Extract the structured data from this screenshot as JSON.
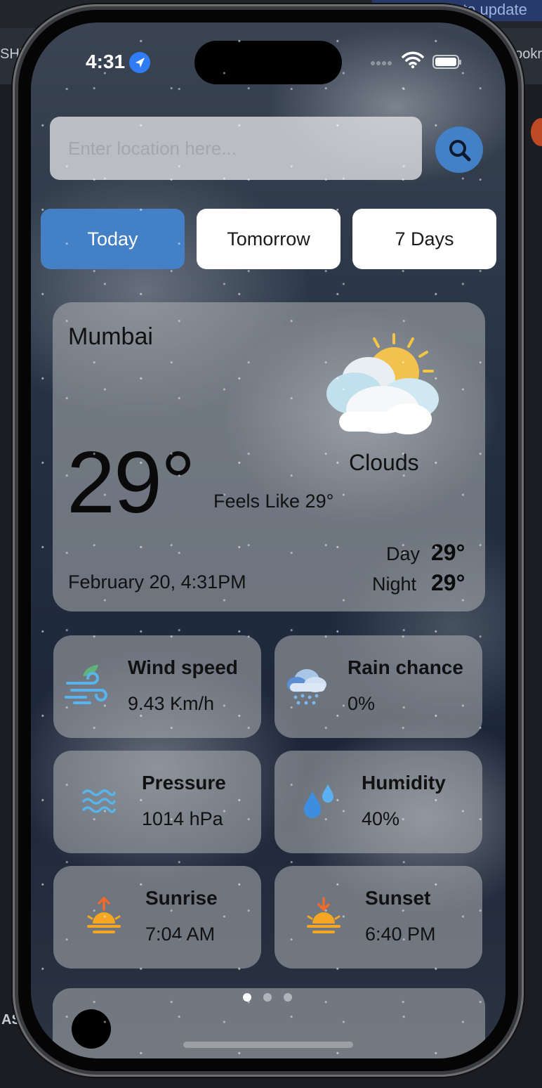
{
  "host": {
    "banner": "Relaunch to update",
    "left_tab": "SHE",
    "right_tab": "ookr",
    "left_bottom": "AS"
  },
  "status_bar": {
    "time": "4:31",
    "icons": [
      "location-arrow-icon",
      "signal-dots-icon",
      "wifi-icon",
      "battery-icon"
    ]
  },
  "search": {
    "placeholder": "Enter location here...",
    "value": "",
    "button_icon": "search-icon"
  },
  "tabs": [
    {
      "label": "Today",
      "active": true
    },
    {
      "label": "Tomorrow",
      "active": false
    },
    {
      "label": "7 Days",
      "active": false
    }
  ],
  "current": {
    "city": "Mumbai",
    "temperature": "29°",
    "condition": "Clouds",
    "condition_icon": "partly-cloudy-sun-icon",
    "feels_like": "Feels Like 29°",
    "date_time": "February 20, 4:31PM",
    "day_label": "Day",
    "day_temp": "29°",
    "night_label": "Night",
    "night_temp": "29°"
  },
  "stats": [
    {
      "title": "Wind speed",
      "value": "9.43 Km/h",
      "icon": "wind-icon"
    },
    {
      "title": "Rain chance",
      "value": "0%",
      "icon": "rain-cloud-icon"
    },
    {
      "title": "Pressure",
      "value": "1014 hPa",
      "icon": "waves-icon"
    },
    {
      "title": "Humidity",
      "value": "40%",
      "icon": "droplets-icon"
    },
    {
      "title": "Sunrise",
      "value": "7:04 AM",
      "icon": "sunrise-icon"
    },
    {
      "title": "Sunset",
      "value": "6:40 PM",
      "icon": "sunset-icon"
    }
  ],
  "pager": {
    "count": 3,
    "active_index": 0
  },
  "colors": {
    "accent": "#4480c5",
    "card": "rgba(175,178,182,0.55)",
    "icon_orange": "#f5a623",
    "icon_blue": "#5bb8f0"
  }
}
